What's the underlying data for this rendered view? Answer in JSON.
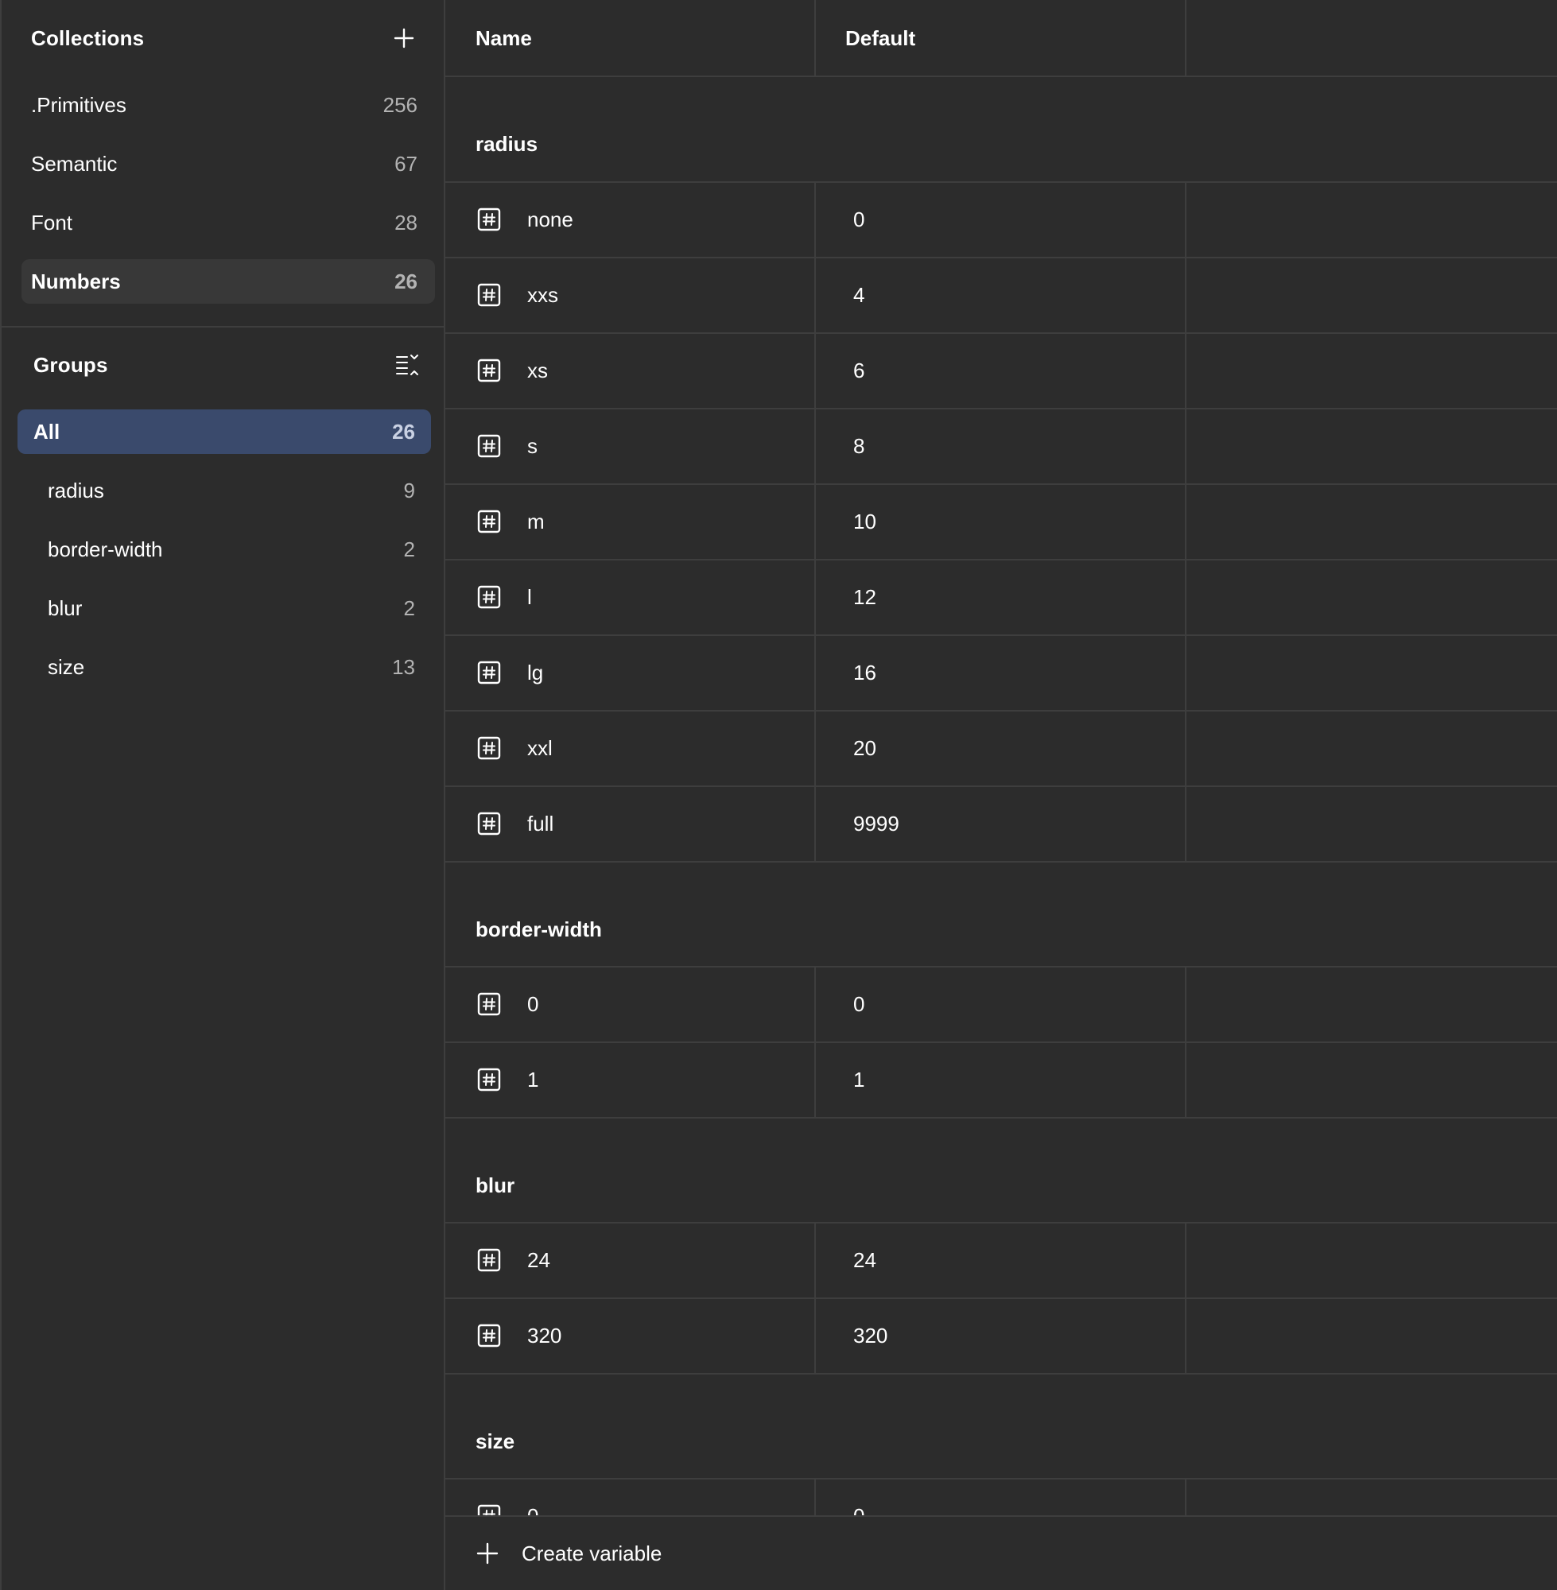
{
  "sidebar": {
    "collections_title": "Collections",
    "collections": [
      {
        "label": ".Primitives",
        "count": "256"
      },
      {
        "label": "Semantic",
        "count": "67"
      },
      {
        "label": "Font",
        "count": "28"
      },
      {
        "label": "Numbers",
        "count": "26"
      }
    ],
    "groups_title": "Groups",
    "groups": [
      {
        "label": "All",
        "count": "26"
      },
      {
        "label": "radius",
        "count": "9"
      },
      {
        "label": "border-width",
        "count": "2"
      },
      {
        "label": "blur",
        "count": "2"
      },
      {
        "label": "size",
        "count": "13"
      }
    ]
  },
  "table": {
    "header_name": "Name",
    "header_default": "Default",
    "groups": [
      {
        "title": "radius",
        "rows": [
          {
            "name": "none",
            "value": "0"
          },
          {
            "name": "xxs",
            "value": "4"
          },
          {
            "name": "xs",
            "value": "6"
          },
          {
            "name": "s",
            "value": "8"
          },
          {
            "name": "m",
            "value": "10"
          },
          {
            "name": "l",
            "value": "12"
          },
          {
            "name": "lg",
            "value": "16"
          },
          {
            "name": "xxl",
            "value": "20"
          },
          {
            "name": "full",
            "value": "9999"
          }
        ]
      },
      {
        "title": "border-width",
        "rows": [
          {
            "name": "0",
            "value": "0"
          },
          {
            "name": "1",
            "value": "1"
          }
        ]
      },
      {
        "title": "blur",
        "rows": [
          {
            "name": "24",
            "value": "24"
          },
          {
            "name": "320",
            "value": "320"
          }
        ]
      },
      {
        "title": "size",
        "rows": [
          {
            "name": "0",
            "value": "0"
          }
        ]
      }
    ]
  },
  "footer": {
    "create_label": "Create variable"
  }
}
